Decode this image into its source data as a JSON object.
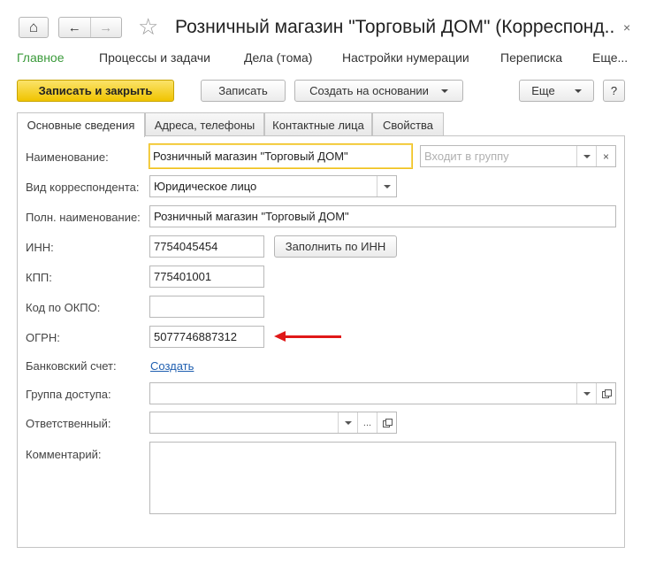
{
  "window": {
    "title": "Розничный магазин \"Торговый ДОМ\" (Корреспонд...",
    "close_glyph": "×"
  },
  "icons": {
    "home": "⌂",
    "back": "←",
    "forward": "→",
    "star": "☆",
    "dropdown": "▾",
    "clear": "×",
    "ellipsis": "..."
  },
  "menu": {
    "items": [
      {
        "label": "Главное",
        "active": true
      },
      {
        "label": "Процессы и задачи"
      },
      {
        "label": "Дела (тома)"
      },
      {
        "label": "Настройки нумерации"
      },
      {
        "label": "Переписка"
      },
      {
        "label": "Еще..."
      }
    ]
  },
  "toolbar": {
    "save_close": "Записать и закрыть",
    "save": "Записать",
    "create_based": "Создать на основании",
    "more": "Еще",
    "help": "?"
  },
  "tabs": [
    {
      "label": "Основные сведения",
      "active": true
    },
    {
      "label": "Адреса, телефоны"
    },
    {
      "label": "Контактные лица"
    },
    {
      "label": "Свойства"
    }
  ],
  "form": {
    "name": {
      "label": "Наименование:",
      "value": "Розничный магазин \"Торговый ДОМ\""
    },
    "group": {
      "placeholder": "Входит в группу"
    },
    "kind": {
      "label": "Вид корреспондента:",
      "value": "Юридическое лицо"
    },
    "full_name": {
      "label": "Полн. наименование:",
      "value": "Розничный магазин \"Торговый ДОМ\""
    },
    "inn": {
      "label": "ИНН:",
      "value": "7754045454",
      "fill_button": "Заполнить по ИНН"
    },
    "kpp": {
      "label": "КПП:",
      "value": "775401001"
    },
    "okpo": {
      "label": "Код по ОКПО:",
      "value": ""
    },
    "ogrn": {
      "label": "ОГРН:",
      "value": "5077746887312"
    },
    "bank": {
      "label": "Банковский счет:",
      "link": "Создать"
    },
    "access": {
      "label": "Группа доступа:",
      "value": ""
    },
    "responsible": {
      "label": "Ответственный:",
      "value": ""
    },
    "comment": {
      "label": "Комментарий:",
      "value": ""
    }
  },
  "colors": {
    "accent_green": "#3a9a3a",
    "primary_button": "#f0c400",
    "link": "#1f5fb0",
    "annotation_arrow": "#e01818"
  }
}
